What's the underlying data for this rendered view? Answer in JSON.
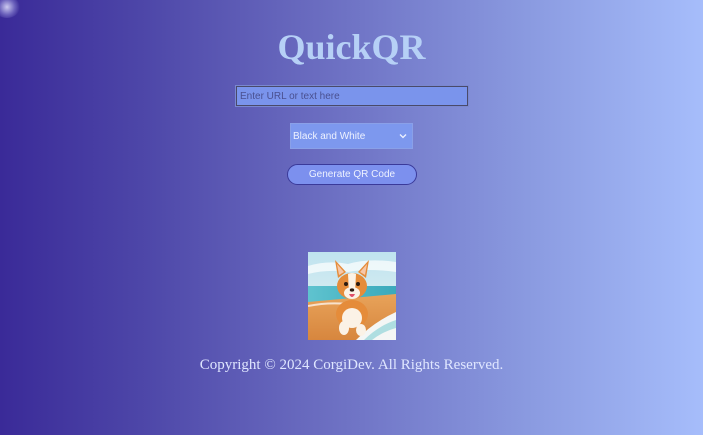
{
  "app": {
    "title": "QuickQR"
  },
  "form": {
    "url_placeholder": "Enter URL or text here",
    "url_value": "",
    "color_scheme": {
      "selected": "Black and White"
    },
    "generate_label": "Generate QR Code"
  },
  "image": {
    "alt": "Corgi running on a beach"
  },
  "footer": {
    "copyright": "Copyright © 2024 CorgiDev. All Rights Reserved."
  }
}
